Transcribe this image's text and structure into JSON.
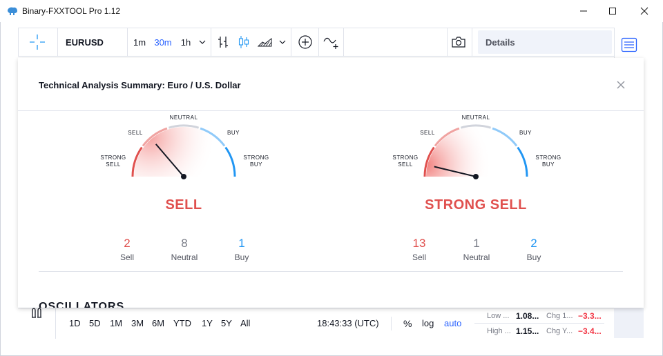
{
  "window": {
    "title": "Binary-FXXTOOL Pro 1.12",
    "controls": {
      "minimize": "minimize-icon",
      "maximize": "maximize-icon",
      "close": "close-icon"
    }
  },
  "toolbar": {
    "symbol": "EURUSD",
    "intervals": [
      "1m",
      "30m",
      "1h"
    ],
    "active_interval": "30m",
    "details_label": "Details"
  },
  "dialog": {
    "title": "Technical Analysis Summary: Euro / U.S. Dollar",
    "gauge_labels": {
      "strong_sell_1": "STRONG",
      "strong_sell_2": "SELL",
      "sell": "SELL",
      "neutral": "NEUTRAL",
      "buy": "BUY",
      "strong_buy_1": "STRONG",
      "strong_buy_2": "BUY"
    },
    "gauges": [
      {
        "verdict": "SELL",
        "needle_value": -0.45,
        "counts": [
          {
            "value": "2",
            "label": "Sell"
          },
          {
            "value": "8",
            "label": "Neutral"
          },
          {
            "value": "1",
            "label": "Buy"
          }
        ]
      },
      {
        "verdict": "STRONG SELL",
        "needle_value": -0.85,
        "counts": [
          {
            "value": "13",
            "label": "Sell"
          },
          {
            "value": "1",
            "label": "Neutral"
          },
          {
            "value": "2",
            "label": "Buy"
          }
        ]
      }
    ],
    "section_heading": "OSCILLATORS"
  },
  "bottombar": {
    "ranges": [
      "1D",
      "5D",
      "1M",
      "3M",
      "6M",
      "YTD",
      "1Y",
      "5Y",
      "All"
    ],
    "time": "18:43:33 (UTC)",
    "percent": "%",
    "log": "log",
    "auto": "auto"
  },
  "watchlist": [
    {
      "label": "Low ...",
      "value": "1.08...",
      "label2": "Chg 1...",
      "value2": "−3.3..."
    },
    {
      "label": "High ...",
      "value": "1.15...",
      "label2": "Chg Y...",
      "value2": "−3.4..."
    }
  ],
  "colors": {
    "sell": "#e0504e",
    "neutral": "#787b86",
    "buy": "#2196f3",
    "accent": "#2962ff"
  }
}
